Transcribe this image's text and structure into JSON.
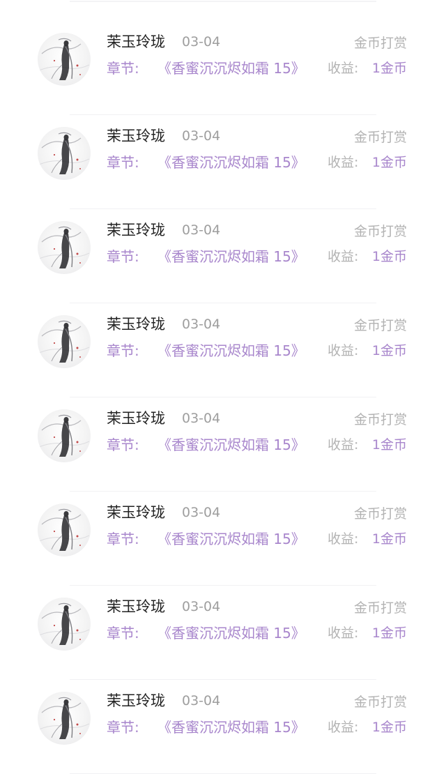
{
  "records": [
    {
      "user_name": "茉玉玲珑",
      "date": "03-04",
      "reward_type": "金币打赏",
      "chapter_label": "章节:",
      "chapter_title": "《香蜜沉沉烬如霜 15》",
      "income_label": "收益:",
      "income_value": "1金币"
    },
    {
      "user_name": "茉玉玲珑",
      "date": "03-04",
      "reward_type": "金币打赏",
      "chapter_label": "章节:",
      "chapter_title": "《香蜜沉沉烬如霜 15》",
      "income_label": "收益:",
      "income_value": "1金币"
    },
    {
      "user_name": "茉玉玲珑",
      "date": "03-04",
      "reward_type": "金币打赏",
      "chapter_label": "章节:",
      "chapter_title": "《香蜜沉沉烬如霜 15》",
      "income_label": "收益:",
      "income_value": "1金币"
    },
    {
      "user_name": "茉玉玲珑",
      "date": "03-04",
      "reward_type": "金币打赏",
      "chapter_label": "章节:",
      "chapter_title": "《香蜜沉沉烬如霜 15》",
      "income_label": "收益:",
      "income_value": "1金币"
    },
    {
      "user_name": "茉玉玲珑",
      "date": "03-04",
      "reward_type": "金币打赏",
      "chapter_label": "章节:",
      "chapter_title": "《香蜜沉沉烬如霜 15》",
      "income_label": "收益:",
      "income_value": "1金币"
    },
    {
      "user_name": "茉玉玲珑",
      "date": "03-04",
      "reward_type": "金币打赏",
      "chapter_label": "章节:",
      "chapter_title": "《香蜜沉沉烬如霜 15》",
      "income_label": "收益:",
      "income_value": "1金币"
    },
    {
      "user_name": "茉玉玲珑",
      "date": "03-04",
      "reward_type": "金币打赏",
      "chapter_label": "章节:",
      "chapter_title": "《香蜜沉沉烬如霜 15》",
      "income_label": "收益:",
      "income_value": "1金币"
    },
    {
      "user_name": "茉玉玲珑",
      "date": "03-04",
      "reward_type": "金币打赏",
      "chapter_label": "章节:",
      "chapter_title": "《香蜜沉沉烬如霜 15》",
      "income_label": "收益:",
      "income_value": "1金币"
    }
  ],
  "colors": {
    "accent": "#a886cc",
    "muted": "#b3b3b3",
    "name": "#222222",
    "date": "#9e9e9e"
  },
  "avatar_icon": "ink-painting-woman-avatar"
}
